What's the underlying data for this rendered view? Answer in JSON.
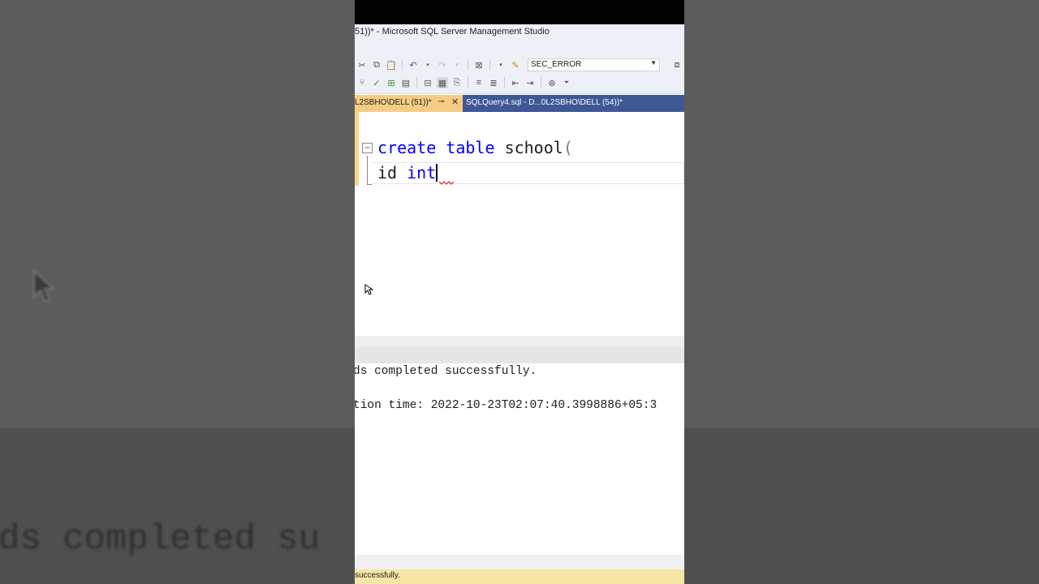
{
  "window": {
    "title": "51))* - Microsoft SQL Server Management Studio"
  },
  "toolbar": {
    "database_select": "SEC_ERROR"
  },
  "tabs": [
    {
      "label": "L2SBHO\\DELL (51))*",
      "active": true
    },
    {
      "label": "SQLQuery4.sql - D...0L2SBHO\\DELL (54))*",
      "active": false
    }
  ],
  "editor": {
    "line1": {
      "kw1": "create",
      "kw2": "table",
      "name": "school",
      "paren": "("
    },
    "line2": {
      "col": "id",
      "type": "int"
    }
  },
  "messages": {
    "line1": "ds completed successfully.",
    "line2": "tion time: 2022-10-23T02:07:40.3998886+05:3"
  },
  "status": {
    "text": "successfully."
  },
  "background": {
    "ghost_text": "ds completed su"
  },
  "colors": {
    "keyword": "#0000ff",
    "tab_active": "#f5cc84",
    "tabbar": "#3e5896",
    "statusbar": "#f5e6a3"
  }
}
